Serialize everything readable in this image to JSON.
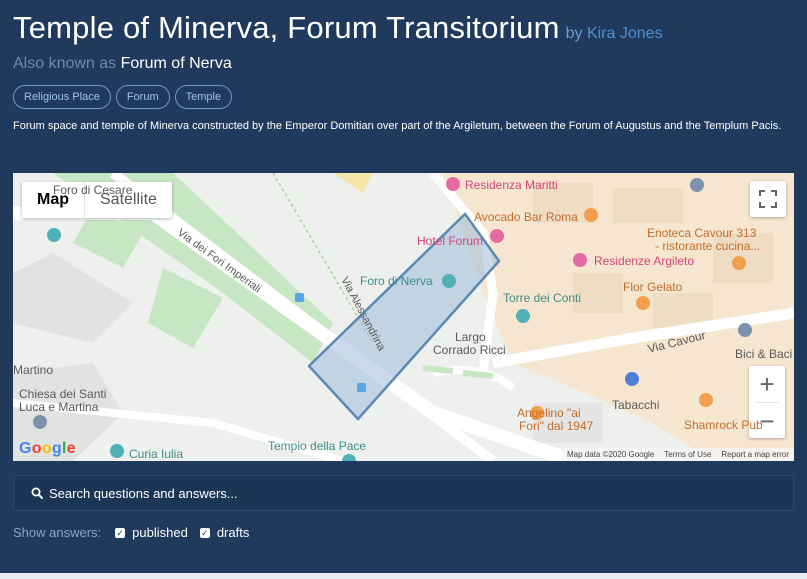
{
  "header": {
    "title": "Temple of Minerva, Forum Transitorium",
    "by_prefix": "by",
    "author": "Kira Jones",
    "aka_prefix": "Also known as",
    "aka_name": "Forum of Nerva"
  },
  "tags": [
    "Religious Place",
    "Forum",
    "Temple"
  ],
  "description": "Forum space and temple of Minerva constructed by the Emperor Domitian over part of the Argiletum, between the Forum of Augustus and the Templum Pacis.",
  "map": {
    "type_buttons": [
      "Map",
      "Satellite"
    ],
    "active_type": "Map",
    "fullscreen_icon": "fullscreen-icon",
    "zoom_in": "+",
    "zoom_out": "−",
    "labels": {
      "residenza_maritti": "Residenza Maritti",
      "avocado_bar": "Avocado Bar Roma",
      "hotel_forum": "Hotel Forum",
      "enoteca": "Enoteca Cavour 313",
      "enoteca_sub": "- ristorante cucina...",
      "residenze_argileto": "Residenze Argileto",
      "flor_gelato": "Flor Gelato",
      "torre_conti": "Torre dei Conti",
      "foro_nerva": "Foro di Nerva",
      "largo": "Largo",
      "corrado": "Corrado Ricci",
      "via_cavour": "Via Cavour",
      "bici_baci": "Bici & Baci",
      "tabacchi": "Tabacchi",
      "angelino_1": "Angelino \"ai",
      "angelino_2": "Fori\" dal 1947",
      "shamrock": "Shamrock Pub",
      "foro_cesare": "Foro di Cesare",
      "via_fori": "Via dei Fori Imperiali",
      "via_alessandrina": "Via Alessandrina",
      "martino": "Martino",
      "chiesa_1": "Chiesa dei Santi",
      "chiesa_2": "Luca e Martina",
      "curia": "Curia Iulia",
      "tempio_pace": "Tempio della Pace"
    },
    "google": "Google",
    "attribution": [
      "Map data ©2020 Google",
      "Terms of Use",
      "Report a map error"
    ],
    "colors": {
      "polygon_fill": "#9fbcd8",
      "polygon_stroke": "#5b89b5",
      "park": "#c7e7c4",
      "road": "#ffffff",
      "building": "#f7e6cf"
    }
  },
  "search": {
    "placeholder": "Search questions and answers..."
  },
  "filters": {
    "label": "Show answers:",
    "options": [
      {
        "label": "published",
        "checked": true
      },
      {
        "label": "drafts",
        "checked": true
      }
    ]
  }
}
